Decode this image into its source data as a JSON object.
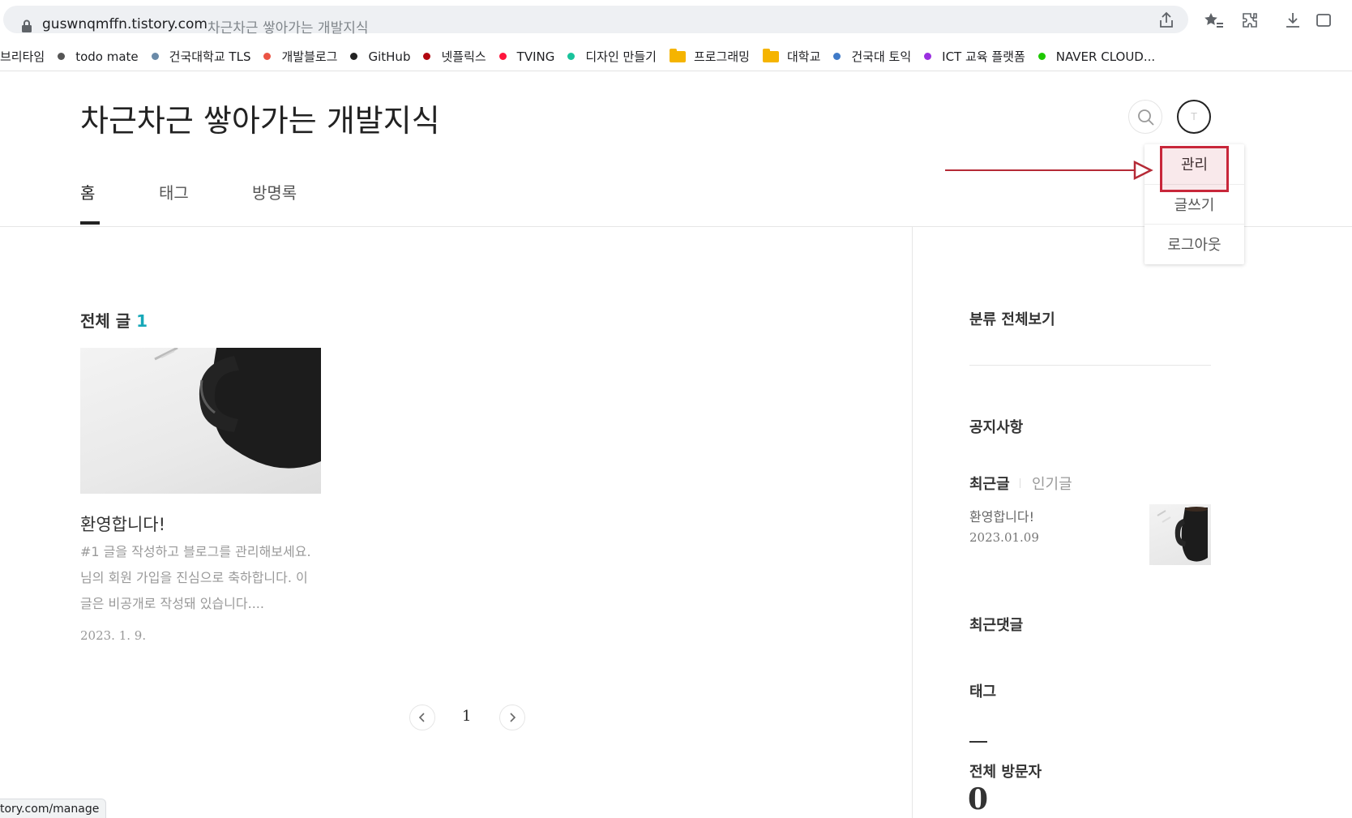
{
  "browser": {
    "url_host": "guswnqmffn.tistory.com",
    "page_title": "차근차근 쌓아가는 개발지식",
    "status_url": "tory.com/manage"
  },
  "bookmarks": [
    {
      "label": "브리타임",
      "kind": "text"
    },
    {
      "label": "todo mate",
      "kind": "dot",
      "color": "#555555"
    },
    {
      "label": "건국대학교 TLS",
      "kind": "dot",
      "color": "#6a8aa8"
    },
    {
      "label": "개발블로그",
      "kind": "dot",
      "color": "#eb5444"
    },
    {
      "label": "GitHub",
      "kind": "dot",
      "color": "#222222"
    },
    {
      "label": "넷플릭스",
      "kind": "dot",
      "color": "#b20710"
    },
    {
      "label": "TVING",
      "kind": "dot",
      "color": "#ff153c"
    },
    {
      "label": "디자인 만들기",
      "kind": "dot",
      "color": "#19c39b"
    },
    {
      "label": "프로그래밍",
      "kind": "folder",
      "color": "#f5b400"
    },
    {
      "label": "대학교",
      "kind": "folder",
      "color": "#f5b400"
    },
    {
      "label": "건국대 토익",
      "kind": "dot",
      "color": "#3f7ac8"
    },
    {
      "label": "ICT 교육 플랫폼",
      "kind": "dot",
      "color": "#9b30e0"
    },
    {
      "label": "NAVER CLOUD...",
      "kind": "dot",
      "color": "#1ec800"
    }
  ],
  "blog": {
    "title": "차근차근 쌓아가는 개발지식",
    "avatar_initial": "T"
  },
  "nav": {
    "items": [
      "홈",
      "태그",
      "방명록"
    ],
    "active_index": 0
  },
  "user_menu": {
    "items": [
      "관리",
      "글쓰기",
      "로그아웃"
    ],
    "highlighted_index": 0,
    "highlight_color": "#c8273a"
  },
  "main": {
    "section_title": "전체 글",
    "post_count": "1",
    "accent_color": "#17a8b8",
    "posts": [
      {
        "title": "환영합니다!",
        "excerpt": "#1 글을 작성하고 블로그를 관리해보세요. 님의 회원 가입을 진심으로 축하합니다. 이 글은 비공개로 작성돼 있습니다....",
        "date": "2023. 1. 9."
      }
    ],
    "pagination": {
      "current": "1"
    }
  },
  "sidebar": {
    "categories_title": "분류 전체보기",
    "notice_title": "공지사항",
    "tabs": [
      "최근글",
      "인기글"
    ],
    "recent_posts": [
      {
        "title": "환영합니다!",
        "date": "2023.01.09"
      }
    ],
    "recent_comments_title": "최근댓글",
    "tags_title": "태그",
    "visitors_title": "전체 방문자",
    "visitors_count": "0"
  }
}
